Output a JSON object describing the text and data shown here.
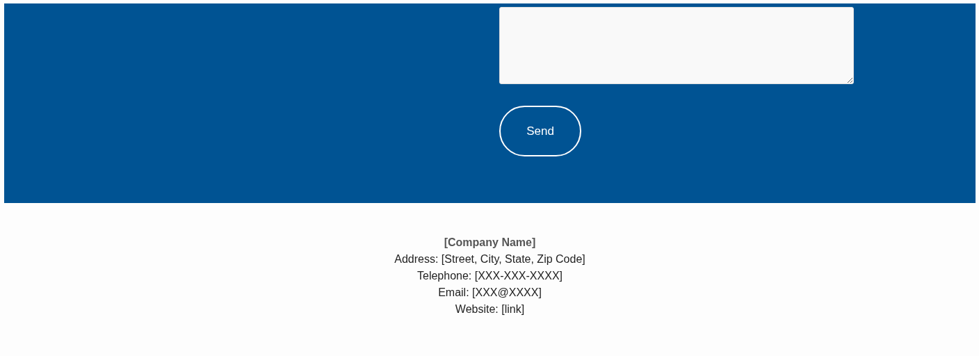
{
  "contact_form": {
    "send_button": {
      "label": "Send"
    }
  },
  "footer": {
    "company_name": "[Company Name]",
    "lines": [
      "Address: [Street, City, State, Zip Code]",
      "Telephone: [XXX-XXX-XXXX]",
      "Email: [XXX@XXXX]",
      "Website: [link]"
    ]
  }
}
